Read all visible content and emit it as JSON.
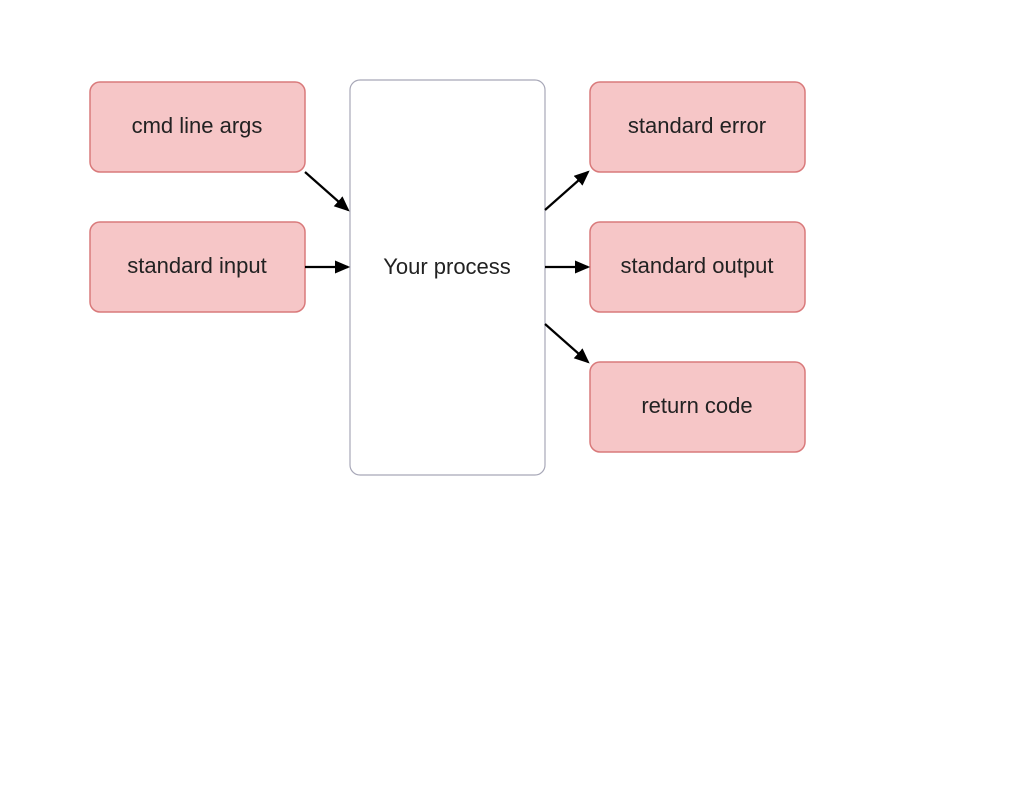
{
  "diagram": {
    "center": {
      "label": "Your process"
    },
    "inputs": {
      "cmdline": {
        "label": "cmd line args"
      },
      "stdin": {
        "label": "standard input"
      }
    },
    "outputs": {
      "stderr": {
        "label": "standard error"
      },
      "stdout": {
        "label": "standard output"
      },
      "retcode": {
        "label": "return code"
      }
    }
  },
  "colors": {
    "pink_fill": "#f6c6c7",
    "pink_stroke": "#d97a7b",
    "center_stroke": "#a8a8b8"
  }
}
